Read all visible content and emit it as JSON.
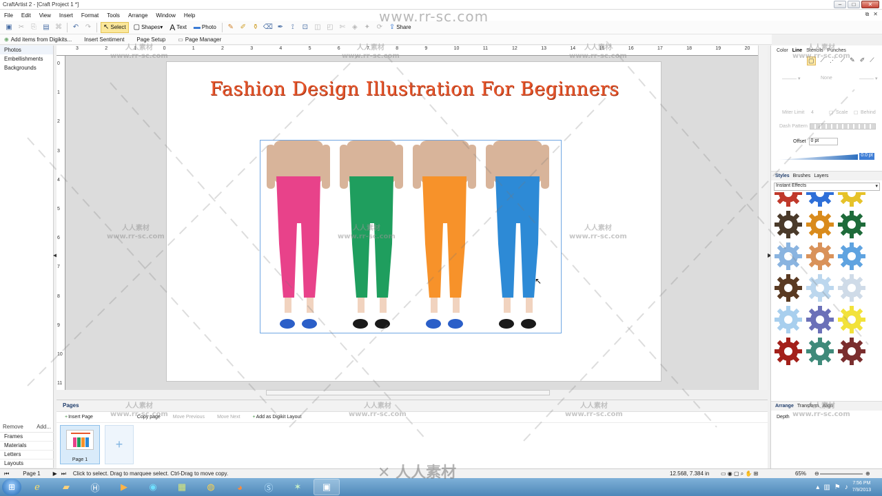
{
  "window": {
    "title": "CraftArtist 2 - [Craft Project 1 *]"
  },
  "menu": [
    "File",
    "Edit",
    "View",
    "Insert",
    "Format",
    "Tools",
    "Arrange",
    "Window",
    "Help"
  ],
  "toolbar": {
    "select_label": "Select",
    "shapes_label": "Shapes",
    "text_label": "Text",
    "photo_label": "Photo",
    "share_label": "Share"
  },
  "actionbar": {
    "add_items": "Add items from Digikits...",
    "insert_sentiment": "Insert Sentiment",
    "page_setup": "Page Setup",
    "page_manager": "Page Manager"
  },
  "left_panel": {
    "tabs": [
      "Photos",
      "Embellishments",
      "Backgrounds"
    ],
    "remove_label": "Remove",
    "add_label": "Add...",
    "bottom_tabs": [
      "Frames",
      "Materials",
      "Letters",
      "Layouts"
    ]
  },
  "ruler": {
    "h_labels": [
      "3",
      "2",
      "1",
      "0",
      "1",
      "2",
      "3",
      "4",
      "5",
      "6",
      "7",
      "8",
      "9",
      "10",
      "11",
      "12",
      "13",
      "14",
      "15",
      "16",
      "17",
      "18",
      "19",
      "20"
    ],
    "v_labels": [
      "0",
      "1",
      "2",
      "3",
      "4",
      "5",
      "6",
      "7",
      "8",
      "9",
      "10",
      "11",
      "12"
    ]
  },
  "canvas": {
    "page_title": "Fashion Design Illustration For Beginners",
    "pants": [
      {
        "color": "#e8428a",
        "shoe": "#2b5fc8"
      },
      {
        "color": "#1f9e5e",
        "shoe": "#1a1a1a"
      },
      {
        "color": "#f7922a",
        "shoe": "#2b5fc8"
      },
      {
        "color": "#2d8ad6",
        "shoe": "#1a1a1a"
      }
    ]
  },
  "pages_panel": {
    "title": "Pages",
    "insert_page": "Insert Page",
    "copy_page": "Copy page",
    "move_previous": "Move Previous",
    "move_next": "Move Next",
    "add_layout": "Add as Digikit Layout",
    "thumb_label": "Page 1"
  },
  "right_panel": {
    "tabs": [
      "Color",
      "Line",
      "Stencils",
      "Punches"
    ],
    "none_label": "None",
    "miter_label": "Miter Limit",
    "miter_value": "4",
    "scale_label": "Scale",
    "behind_label": "Behind",
    "dash_label": "Dash Pattern",
    "offset_label": "Offset",
    "offset_value": "0 pt",
    "slider_value": "0.0 pt",
    "styles_tabs": [
      "Styles",
      "Brushes",
      "Layers"
    ],
    "styles_category": "Instant Effects",
    "gears": [
      "#c0392b",
      "#2e6fd8",
      "#e6c229",
      "#4a3a2a",
      "#d98b1c",
      "#1e6b3a",
      "#8ab4e0",
      "#d9925a",
      "#5fa3e0",
      "#5a3a22",
      "#bcd7ee",
      "#cfdbe8",
      "#a8cfee",
      "#6b70b8",
      "#f2e23a",
      "#a3201a",
      "#3f8a7a",
      "#7a2e2e"
    ],
    "arrange_tabs": [
      "Arrange",
      "Transform",
      "Align"
    ],
    "depth_label": "Depth"
  },
  "status": {
    "page_label": "Page 1",
    "hint": "Click to select. Drag to marquee select. Ctrl-Drag to move copy.",
    "coords": "12.568, 7.384 in",
    "zoom": "65%"
  },
  "taskbar": {
    "time": "7:56 PM",
    "date": "7/9/2013"
  },
  "watermark": {
    "site": "www.rr-sc.com",
    "cn": "人人素材",
    "bottom": "人人素材"
  }
}
